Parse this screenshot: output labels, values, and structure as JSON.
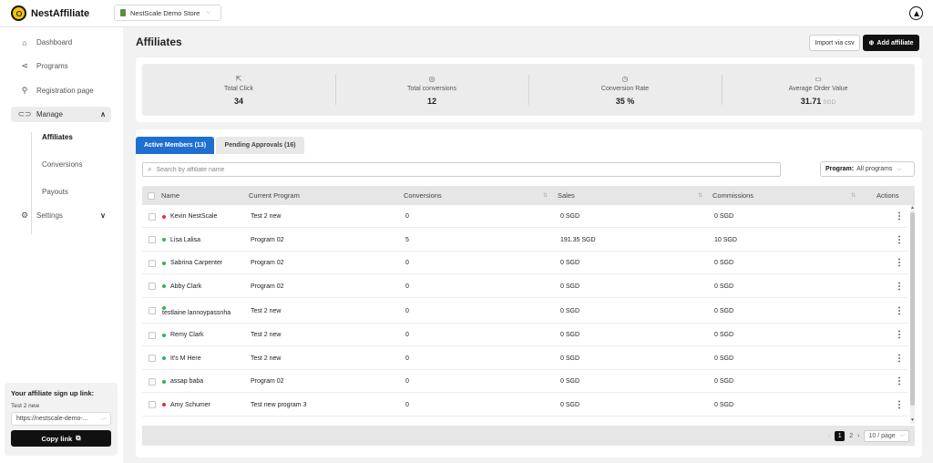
{
  "app": {
    "name": "NestAffiliate",
    "store": "NestScale Demo Store"
  },
  "sidebar": {
    "items": [
      {
        "label": "Dashboard",
        "icon": "home-icon"
      },
      {
        "label": "Programs",
        "icon": "share-icon"
      },
      {
        "label": "Registration page",
        "icon": "user-add-icon"
      },
      {
        "label": "Manage",
        "icon": "toggle-icon"
      },
      {
        "label": "Settings",
        "icon": "gear-icon"
      }
    ],
    "manage_sub": [
      "Affiliates",
      "Conversions",
      "Payouts"
    ],
    "signup": {
      "title": "Your affiliate sign up link:",
      "program": "Test 2 new",
      "link": "https://nestscale-demo-...",
      "copy_label": "Copy link"
    }
  },
  "page": {
    "title": "Affiliates",
    "import_label": "Import via csv",
    "add_label": "Add affiliate"
  },
  "stats": [
    {
      "label": "Total Click",
      "value": "34",
      "unit": "",
      "icon": "cursor-icon"
    },
    {
      "label": "Total conversions",
      "value": "12",
      "unit": "",
      "icon": "target-icon"
    },
    {
      "label": "Conversion Rate",
      "value": "35 %",
      "unit": "",
      "icon": "clock-icon"
    },
    {
      "label": "Average Order Value",
      "value": "31.71",
      "unit": "SGD",
      "icon": "wallet-icon"
    }
  ],
  "tabs": [
    {
      "label": "Active Members (13)"
    },
    {
      "label": "Pending Approvals (16)"
    }
  ],
  "search": {
    "placeholder": "Search by affiliate name"
  },
  "filter": {
    "label": "Program:",
    "value": "All programs"
  },
  "table": {
    "headers": [
      "Name",
      "Current Program",
      "Conversions",
      "Sales",
      "Commissions",
      "Actions"
    ],
    "rows": [
      {
        "name": "Kevin NestScale",
        "status": "red",
        "program": "Test 2 new",
        "conversions": "0",
        "sales": "0 SGD",
        "commissions": "0 SGD"
      },
      {
        "name": "Lisa Lalisa",
        "status": "green",
        "program": "Program 02",
        "conversions": "5",
        "sales": "191.35 SGD",
        "commissions": "10 SGD"
      },
      {
        "name": "Sabrina Carpenter",
        "status": "green",
        "program": "Program 02",
        "conversions": "0",
        "sales": "0 SGD",
        "commissions": "0 SGD"
      },
      {
        "name": "Abby Clark",
        "status": "green",
        "program": "Program 02",
        "conversions": "0",
        "sales": "0 SGD",
        "commissions": "0 SGD"
      },
      {
        "name": "testlaine lannoypassnha",
        "status": "green",
        "program": "Test 2 new",
        "conversions": "0",
        "sales": "0 SGD",
        "commissions": "0 SGD"
      },
      {
        "name": "Remy Clark",
        "status": "green",
        "program": "Test 2 new",
        "conversions": "0",
        "sales": "0 SGD",
        "commissions": "0 SGD"
      },
      {
        "name": "It's M Here",
        "status": "green",
        "program": "Test 2 new",
        "conversions": "0",
        "sales": "0 SGD",
        "commissions": "0 SGD"
      },
      {
        "name": "assap baba",
        "status": "green",
        "program": "Program 02",
        "conversions": "0",
        "sales": "0 SGD",
        "commissions": "0 SGD"
      },
      {
        "name": "Amy Schumer",
        "status": "red",
        "program": "Test new program 3",
        "conversions": "0",
        "sales": "0 SGD",
        "commissions": "0 SGD"
      }
    ]
  },
  "pagination": {
    "current": "1",
    "next": "2",
    "page_size": "10 / page"
  },
  "colors": {
    "accent": "#1f6fd1",
    "green": "#2db84c",
    "red": "#e0342f",
    "dark": "#111111"
  }
}
